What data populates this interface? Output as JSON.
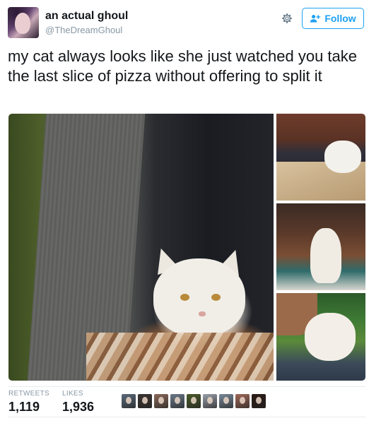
{
  "author": {
    "display_name": "an actual ghoul",
    "handle": "@TheDreamGhoul",
    "avatar_icon": "user-avatar"
  },
  "actions": {
    "settings_icon": "gear-icon",
    "follow_label": "Follow",
    "follow_icon": "add-user-icon",
    "accent_color": "#1da1f2"
  },
  "tweet": {
    "text": "my cat always looks like she just watched you take the last slice of pizza without offering to split it"
  },
  "media": {
    "photos": [
      "cat-under-blanket-photo",
      "cat-in-box-photo",
      "cat-sitting-on-rug-photo",
      "person-holding-cat-photo"
    ]
  },
  "stats": {
    "retweets_label": "RETWEETS",
    "retweets_value": "1,119",
    "likes_label": "LIKES",
    "likes_value": "1,936"
  },
  "likers": [
    {
      "color": "#5a6a7a"
    },
    {
      "color": "#3a3430"
    },
    {
      "color": "#8a6a5a"
    },
    {
      "color": "#6a7a8a"
    },
    {
      "color": "#4a5a2a"
    },
    {
      "color": "#9aa0aa"
    },
    {
      "color": "#7a8a9a"
    },
    {
      "color": "#a06a5a"
    },
    {
      "color": "#2a1a14"
    }
  ]
}
